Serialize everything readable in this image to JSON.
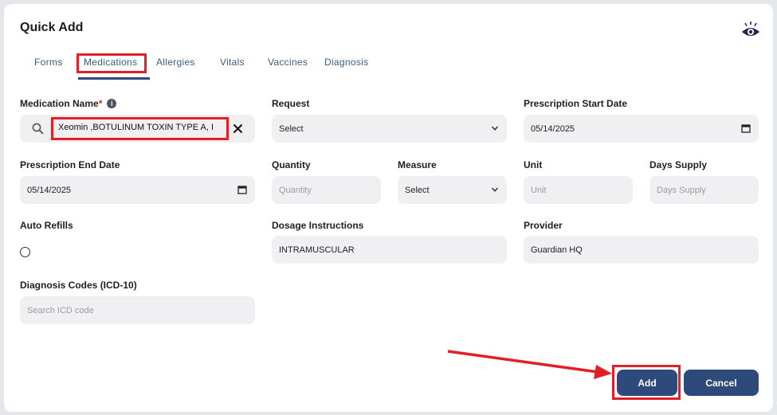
{
  "header": {
    "title": "Quick Add",
    "eye_icon": "eye-icon"
  },
  "tabs": [
    {
      "label": "Forms"
    },
    {
      "label": "Medications",
      "active": true
    },
    {
      "label": "Allergies"
    },
    {
      "label": "Vitals"
    },
    {
      "label": "Vaccines"
    },
    {
      "label": "Diagnosis"
    }
  ],
  "form": {
    "medication_name": {
      "label": "Medication Name",
      "required_mark": "*",
      "value": "Xeomin ,BOTULINUM TOXIN TYPE A, I"
    },
    "request": {
      "label": "Request",
      "value": "Select"
    },
    "prescription_start_date": {
      "label": "Prescription Start Date",
      "value": "05/14/2025"
    },
    "prescription_end_date": {
      "label": "Prescription End Date",
      "value": "05/14/2025"
    },
    "quantity": {
      "label": "Quantity",
      "placeholder": "Quantity"
    },
    "measure": {
      "label": "Measure",
      "value": "Select"
    },
    "unit": {
      "label": "Unit",
      "placeholder": "Unit"
    },
    "days_supply": {
      "label": "Days Supply",
      "placeholder": "Days Supply"
    },
    "auto_refills": {
      "label": "Auto Refills"
    },
    "dosage_instructions": {
      "label": "Dosage Instructions",
      "value": "INTRAMUSCULAR"
    },
    "provider": {
      "label": "Provider",
      "value": "Guardian HQ"
    },
    "diagnosis_codes": {
      "label": "Diagnosis Codes (ICD-10)",
      "placeholder": "Search ICD code"
    }
  },
  "actions": {
    "add_label": "Add",
    "cancel_label": "Cancel"
  },
  "colors": {
    "primary": "#2e4a7a",
    "annotation_red": "#e01f26",
    "field_bg": "#f0f0f2"
  }
}
